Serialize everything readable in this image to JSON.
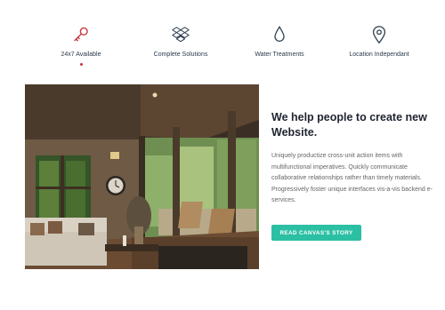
{
  "colors": {
    "accent_red": "#c8333f",
    "accent_teal": "#2bbfa4",
    "icon_dark": "#2c3e50"
  },
  "tabs": [
    {
      "label": "24x7 Available",
      "icon": "key-icon",
      "active": true
    },
    {
      "label": "Complete Solutions",
      "icon": "dropbox-icon",
      "active": false
    },
    {
      "label": "Water Treatments",
      "icon": "water-drop-icon",
      "active": false
    },
    {
      "label": "Location Independant",
      "icon": "map-pin-icon",
      "active": false
    }
  ],
  "content": {
    "title": "We help people to create new Website.",
    "body": "Uniquely productize cross-unit action items with multifunctional imperatives. Quickly communicate collaborative relationships rather than timely materials. Progressively foster unique interfaces vis-a-vis backend e-services.",
    "cta_label": "READ CANVAS'S STORY"
  },
  "image": {
    "subject": "living-room-photo"
  }
}
